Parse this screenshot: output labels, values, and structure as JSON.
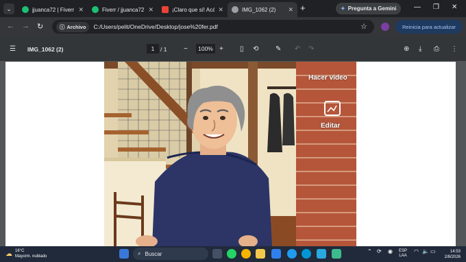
{
  "tabs": [
    {
      "label": "jjuanca72 | Fiverr",
      "favicon": "fiverr-icon",
      "color": "#1dbf73",
      "active": false
    },
    {
      "label": "Fiverr / jjuanca72",
      "favicon": "fiverr-icon",
      "color": "#1dbf73",
      "active": false
    },
    {
      "label": "¡Claro que sí! Acá",
      "favicon": "gmail-icon",
      "color": "#ea4335",
      "active": false
    },
    {
      "label": "IMG_1062 (2)",
      "favicon": "globe-icon",
      "color": "#9aa0a6",
      "active": true
    }
  ],
  "gemini_button": "Pregunta a Gemini",
  "address": {
    "chip": "Archivo",
    "url": "C:/Users/pelit/OneDrive/Desktop/jose%20fer.pdf"
  },
  "update_button": "Reinicia para actualizar",
  "pdf": {
    "title": "IMG_1062 (2)",
    "current_page": "1",
    "page_separator": "/",
    "total_pages": "1",
    "zoom": "100%"
  },
  "image_overlay": {
    "make_video": "Hacer video",
    "edit": "Editar"
  },
  "taskbar": {
    "temperature": "16°C",
    "weather": "Mayorm. nublado",
    "search_placeholder": "Buscar",
    "language_top": "ESP",
    "language_bottom": "LAA",
    "time": "14:53",
    "date": "2/8/2026"
  },
  "colors": {
    "accent": "#a8c7fa",
    "chrome_dark": "#202124",
    "toolbar": "#35363a",
    "pdf_bar": "#323639"
  }
}
